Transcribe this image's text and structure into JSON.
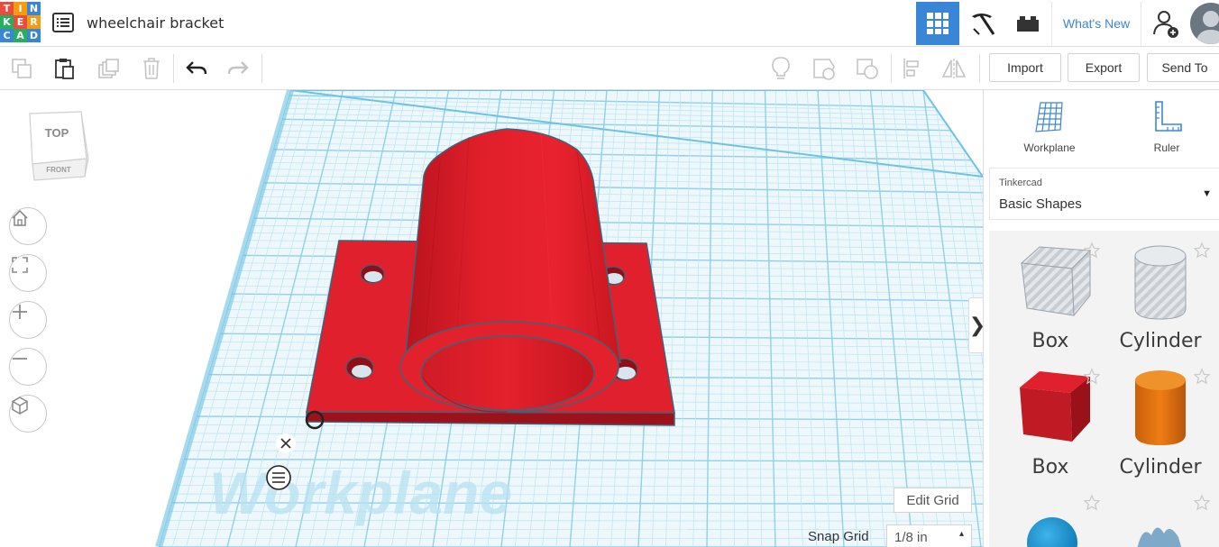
{
  "app": {
    "logo_letters": [
      "T",
      "I",
      "N",
      "K",
      "E",
      "R",
      "C",
      "A",
      "D"
    ],
    "logo_colors": [
      "#e74c3c",
      "#f39c12",
      "#3a86d6",
      "#27ae60",
      "#e74c3c",
      "#f39c12",
      "#3a86d6",
      "#27ae60",
      "#3a86d6"
    ],
    "design_title": "wheelchair bracket",
    "accent_color": "#3a86d6"
  },
  "header": {
    "whats_new_label": "What's New"
  },
  "toolbar": {
    "import_label": "Import",
    "export_label": "Export",
    "send_to_label": "Send To",
    "icons": [
      "copy-icon",
      "paste-icon",
      "duplicate-icon",
      "delete-icon",
      "undo-icon",
      "redo-icon",
      "note-icon",
      "shape-align-icon",
      "group-icon",
      "align-icon",
      "mirror-icon"
    ]
  },
  "view_cube": {
    "top_label": "TOP",
    "front_label": "FRONT"
  },
  "workplane": {
    "watermark": "Workplane",
    "edit_grid_label": "Edit Grid",
    "snap_grid_label": "Snap Grid",
    "snap_grid_value": "1/8 in",
    "object_color": "#e0202c"
  },
  "panel": {
    "workplane_label": "Workplane",
    "ruler_label": "Ruler",
    "library_source": "Tinkercad",
    "library_name": "Basic Shapes",
    "shapes": [
      {
        "label": "Box",
        "kind": "hole-box"
      },
      {
        "label": "Cylinder",
        "kind": "hole-cylinder"
      },
      {
        "label": "Box",
        "kind": "box",
        "color": "#cc1f2b"
      },
      {
        "label": "Cylinder",
        "kind": "cylinder",
        "color": "#e87511"
      }
    ]
  }
}
